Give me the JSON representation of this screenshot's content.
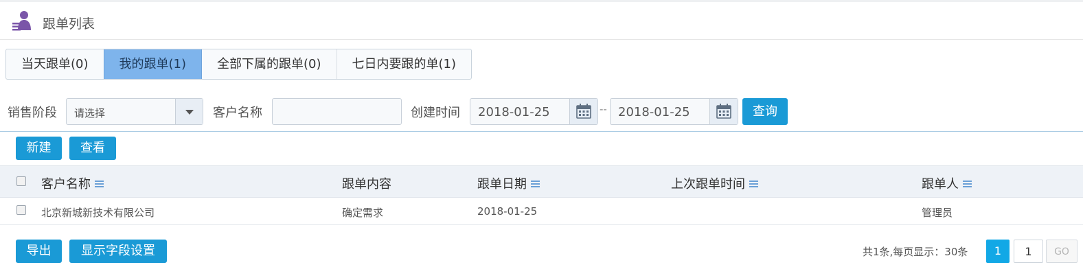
{
  "header": {
    "title": "跟单列表",
    "icon": "user-list-icon"
  },
  "tabs": [
    {
      "label": "当天跟单(0)",
      "active": false
    },
    {
      "label": "我的跟单(1)",
      "active": true
    },
    {
      "label": "全部下属的跟单(0)",
      "active": false
    },
    {
      "label": "七日内要跟的单(1)",
      "active": false
    }
  ],
  "filters": {
    "stage_label": "销售阶段",
    "stage_value": "请选择",
    "customer_label": "客户名称",
    "customer_value": "",
    "created_label": "创建时间",
    "date_from": "2018-01-25",
    "date_separator": "--",
    "date_to": "2018-01-25",
    "query_label": "查询"
  },
  "toolbar": {
    "new_label": "新建",
    "view_label": "查看"
  },
  "table": {
    "columns": [
      "客户名称",
      "跟单内容",
      "跟单日期",
      "上次跟单时间",
      "跟单人"
    ],
    "rows": [
      {
        "customer": "北京新城新技术有限公司",
        "content": "确定需求",
        "date": "2018-01-25",
        "last_time": "",
        "owner": "管理员"
      }
    ]
  },
  "footer": {
    "export_label": "导出",
    "fields_label": "显示字段设置",
    "page_info": "共1条,每页显示：30条",
    "current_page": "1",
    "page_input": "1",
    "go_label": "GO"
  },
  "colors": {
    "primary": "#1a9ad6",
    "active_tab": "#7eb4ec",
    "page_current": "#12a8e6"
  }
}
